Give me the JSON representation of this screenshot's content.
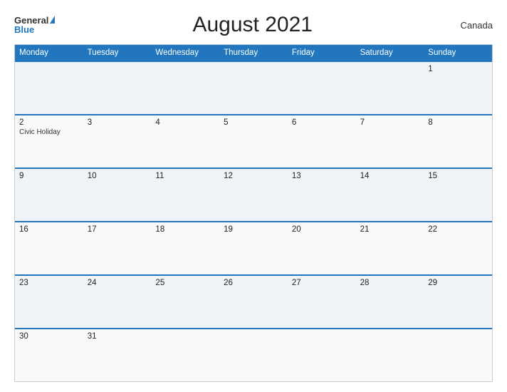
{
  "header": {
    "logo_general": "General",
    "logo_blue": "Blue",
    "title": "August 2021",
    "country": "Canada"
  },
  "calendar": {
    "days_of_week": [
      "Monday",
      "Tuesday",
      "Wednesday",
      "Thursday",
      "Friday",
      "Saturday",
      "Sunday"
    ],
    "rows": [
      [
        {
          "day": "",
          "event": ""
        },
        {
          "day": "",
          "event": ""
        },
        {
          "day": "",
          "event": ""
        },
        {
          "day": "",
          "event": ""
        },
        {
          "day": "",
          "event": ""
        },
        {
          "day": "",
          "event": ""
        },
        {
          "day": "1",
          "event": ""
        }
      ],
      [
        {
          "day": "2",
          "event": "Civic Holiday"
        },
        {
          "day": "3",
          "event": ""
        },
        {
          "day": "4",
          "event": ""
        },
        {
          "day": "5",
          "event": ""
        },
        {
          "day": "6",
          "event": ""
        },
        {
          "day": "7",
          "event": ""
        },
        {
          "day": "8",
          "event": ""
        }
      ],
      [
        {
          "day": "9",
          "event": ""
        },
        {
          "day": "10",
          "event": ""
        },
        {
          "day": "11",
          "event": ""
        },
        {
          "day": "12",
          "event": ""
        },
        {
          "day": "13",
          "event": ""
        },
        {
          "day": "14",
          "event": ""
        },
        {
          "day": "15",
          "event": ""
        }
      ],
      [
        {
          "day": "16",
          "event": ""
        },
        {
          "day": "17",
          "event": ""
        },
        {
          "day": "18",
          "event": ""
        },
        {
          "day": "19",
          "event": ""
        },
        {
          "day": "20",
          "event": ""
        },
        {
          "day": "21",
          "event": ""
        },
        {
          "day": "22",
          "event": ""
        }
      ],
      [
        {
          "day": "23",
          "event": ""
        },
        {
          "day": "24",
          "event": ""
        },
        {
          "day": "25",
          "event": ""
        },
        {
          "day": "26",
          "event": ""
        },
        {
          "day": "27",
          "event": ""
        },
        {
          "day": "28",
          "event": ""
        },
        {
          "day": "29",
          "event": ""
        }
      ],
      [
        {
          "day": "30",
          "event": ""
        },
        {
          "day": "31",
          "event": ""
        },
        {
          "day": "",
          "event": ""
        },
        {
          "day": "",
          "event": ""
        },
        {
          "day": "",
          "event": ""
        },
        {
          "day": "",
          "event": ""
        },
        {
          "day": "",
          "event": ""
        }
      ]
    ]
  }
}
